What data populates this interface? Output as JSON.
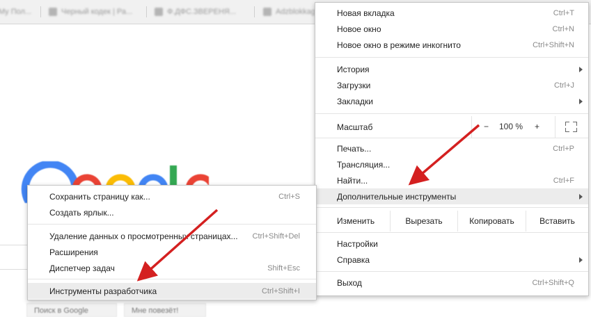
{
  "bookmarks": [
    {
      "label": "My Пол...",
      "icon": "folder-icon"
    },
    {
      "label": "Черный кодек | Ра...",
      "icon": "globe-icon"
    },
    {
      "label": "Ф.ДФС.ЗВЕРЕНЯ...",
      "icon": "doc-icon"
    },
    {
      "label": "Adzblokkagy",
      "icon": "person-icon"
    }
  ],
  "google_buttons": [
    "Поиск в Google",
    "Мне повезёт!"
  ],
  "menu": {
    "items": [
      {
        "label": "Новая вкладка",
        "shortcut": "Ctrl+T"
      },
      {
        "label": "Новое окно",
        "shortcut": "Ctrl+N"
      },
      {
        "label": "Новое окно в режиме инкогнито",
        "shortcut": "Ctrl+Shift+N"
      },
      {
        "label": "История",
        "shortcut": ""
      },
      {
        "label": "Загрузки",
        "shortcut": "Ctrl+J"
      },
      {
        "label": "Закладки",
        "shortcut": ""
      },
      {
        "label": "Печать...",
        "shortcut": "Ctrl+P"
      },
      {
        "label": "Трансляция...",
        "shortcut": ""
      },
      {
        "label": "Найти...",
        "shortcut": "Ctrl+F"
      },
      {
        "label": "Дополнительные инструменты",
        "shortcut": ""
      },
      {
        "label": "Настройки",
        "shortcut": ""
      },
      {
        "label": "Справка",
        "shortcut": ""
      },
      {
        "label": "Выход",
        "shortcut": "Ctrl+Shift+Q"
      }
    ],
    "zoom": {
      "label": "Масштаб",
      "minus": "−",
      "value": "100 %",
      "plus": "+"
    },
    "edit": {
      "label": "Изменить",
      "cut": "Вырезать",
      "copy": "Копировать",
      "paste": "Вставить"
    }
  },
  "submenu": {
    "items": [
      {
        "label": "Сохранить страницу как...",
        "shortcut": "Ctrl+S"
      },
      {
        "label": "Создать ярлык...",
        "shortcut": ""
      },
      {
        "label": "Удаление данных о просмотренных страницах...",
        "shortcut": "Ctrl+Shift+Del"
      },
      {
        "label": "Расширения",
        "shortcut": ""
      },
      {
        "label": "Диспетчер задач",
        "shortcut": "Shift+Esc"
      },
      {
        "label": "Инструменты разработчика",
        "shortcut": "Ctrl+Shift+I"
      }
    ]
  },
  "colors": {
    "arrow": "#d42020",
    "highlight": "#ececec",
    "google_blue": "#4285f4",
    "google_red": "#ea4335",
    "google_yellow": "#fbbc05",
    "google_green": "#34a853"
  }
}
